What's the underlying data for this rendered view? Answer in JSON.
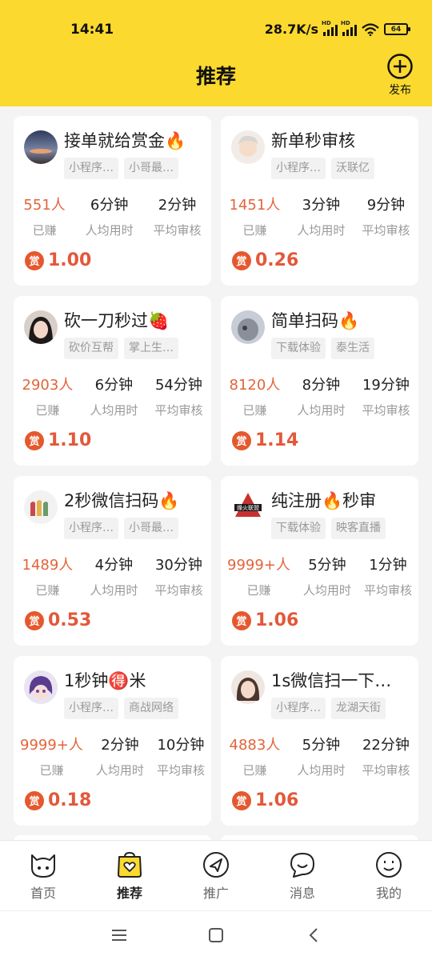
{
  "status": {
    "time": "14:41",
    "speed": "28.7K/s",
    "battery": "64"
  },
  "header": {
    "title": "推荐",
    "publish_label": "发布"
  },
  "cards": [
    {
      "title": "接单就给赏金🔥",
      "tags": [
        "小程序…",
        "小哥最…"
      ],
      "earned": "551人",
      "avg_time": "6分钟",
      "avg_review": "2分钟",
      "reward": "1.00"
    },
    {
      "title": "新单秒审核",
      "tags": [
        "小程序…",
        "沃联亿"
      ],
      "earned": "1451人",
      "avg_time": "3分钟",
      "avg_review": "9分钟",
      "reward": "0.26"
    },
    {
      "title": "砍一刀秒过🍓",
      "tags": [
        "砍价互帮",
        "掌上生…"
      ],
      "earned": "2903人",
      "avg_time": "6分钟",
      "avg_review": "54分钟",
      "reward": "1.10"
    },
    {
      "title": "简单扫码🔥",
      "tags": [
        "下载体验",
        "泰生活"
      ],
      "earned": "8120人",
      "avg_time": "8分钟",
      "avg_review": "19分钟",
      "reward": "1.14"
    },
    {
      "title": "2秒微信扫码🔥",
      "tags": [
        "小程序…",
        "小哥最…"
      ],
      "earned": "1489人",
      "avg_time": "4分钟",
      "avg_review": "30分钟",
      "reward": "0.53"
    },
    {
      "title": "纯注册🔥秒审",
      "tags": [
        "下载体验",
        "映客直播"
      ],
      "earned": "9999+人",
      "avg_time": "5分钟",
      "avg_review": "1分钟",
      "reward": "1.06"
    },
    {
      "title": "1秒钟🉐米",
      "tags": [
        "小程序…",
        "商战网络"
      ],
      "earned": "9999+人",
      "avg_time": "2分钟",
      "avg_review": "10分钟",
      "reward": "0.18"
    },
    {
      "title": "1s微信扫一下…",
      "tags": [
        "小程序…",
        "龙湖天街"
      ],
      "earned": "4883人",
      "avg_time": "5分钟",
      "avg_review": "22分钟",
      "reward": "1.06"
    }
  ],
  "labels": {
    "earned": "已赚",
    "avg_time": "人均用时",
    "avg_review": "平均审核",
    "reward_badge": "赏"
  },
  "tabs": [
    {
      "label": "首页",
      "icon": "cat-face-icon"
    },
    {
      "label": "推荐",
      "icon": "heart-bag-icon",
      "active": true
    },
    {
      "label": "推广",
      "icon": "send-arrow-icon"
    },
    {
      "label": "消息",
      "icon": "chat-bubble-icon"
    },
    {
      "label": "我的",
      "icon": "smile-face-icon"
    }
  ],
  "colors": {
    "brand_yellow": "#fbd92e",
    "accent_orange": "#e3643a",
    "reward_red": "#e5582e"
  }
}
